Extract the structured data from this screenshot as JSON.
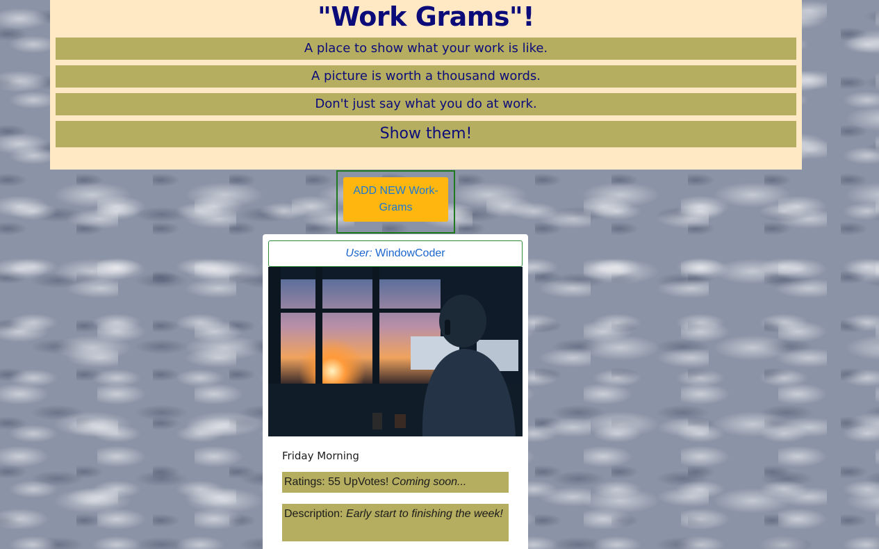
{
  "header": {
    "title": "\"Work Grams\"!",
    "taglines": [
      "A place to show what your work is like.",
      "A picture is worth a thousand words.",
      "Don't just say what you do at work.",
      "Show them!"
    ]
  },
  "actions": {
    "add_button_label": "ADD NEW Work-Grams"
  },
  "post": {
    "user_label": "User:",
    "username": "WindowCoder",
    "title": "Friday Morning",
    "ratings_label": "Ratings: 55 UpVotes!",
    "ratings_note": "Coming soon...",
    "description_label": "Description:",
    "description_text": "Early start to finishing the week!"
  },
  "colors": {
    "header_bg": "#ffe8c4",
    "tagline_bg": "#b5ad5f",
    "title_text": "#0b0b7a",
    "button_bg": "#ffb70f",
    "button_text": "#1a78d6",
    "link_text": "#1a66cc",
    "border_green": "#1f7a1f"
  }
}
